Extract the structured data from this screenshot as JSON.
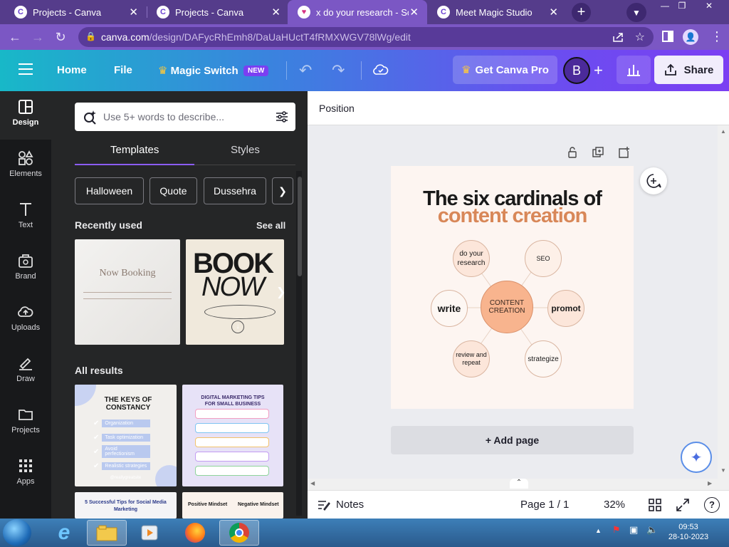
{
  "browser": {
    "tabs": [
      {
        "label": "Projects - Canva",
        "active": false
      },
      {
        "label": "Projects - Canva",
        "active": false
      },
      {
        "label": "x do your research - Soci",
        "active": true
      },
      {
        "label": "Meet Magic Studio",
        "active": false
      }
    ],
    "close_glyph": "✕",
    "new_tab_glyph": "+",
    "url_domain": "canva.com",
    "url_path": "/design/DAFycRhEmh8/DaUaHUctT4fRMXWGV78lWg/edit"
  },
  "header": {
    "home": "Home",
    "file": "File",
    "magic_switch": "Magic Switch",
    "new_badge": "NEW",
    "get_pro": "Get Canva Pro",
    "avatar_initial": "B",
    "share": "Share"
  },
  "rail": {
    "items": [
      {
        "label": "Design",
        "icon": "design-icon"
      },
      {
        "label": "Elements",
        "icon": "elements-icon"
      },
      {
        "label": "Text",
        "icon": "text-icon"
      },
      {
        "label": "Brand",
        "icon": "brand-icon"
      },
      {
        "label": "Uploads",
        "icon": "upload-cloud-icon"
      },
      {
        "label": "Draw",
        "icon": "draw-icon"
      },
      {
        "label": "Projects",
        "icon": "folder-icon"
      },
      {
        "label": "Apps",
        "icon": "apps-grid-icon"
      }
    ]
  },
  "panel": {
    "search_placeholder": "Use 5+ words to describe...",
    "tabs": [
      "Templates",
      "Styles"
    ],
    "chips": [
      "Halloween",
      "Quote",
      "Dussehra"
    ],
    "recently_used": "Recently used",
    "see_all": "See all",
    "all_results": "All results",
    "thumb_now_booking": "Now Booking",
    "thumb_book": "BOOK",
    "thumb_now": "NOW",
    "thumb_keys_title": "THE KEYS OF CONSTANCY",
    "thumb_keys_items": [
      "Organization",
      "Task optimization",
      "Avoid perfectionism",
      "Realistic strategies"
    ],
    "thumb_keys_handle": "@reallygreatsite",
    "thumb_marketing_title": "DIGITAL MARKETING TIPS FOR SMALL BUSINESS",
    "thumb_social_title": "5 Successful Tips for Social Media Marketing",
    "thumb_positive": "Positive Mindset",
    "thumb_negative": "Negative Mindset"
  },
  "canvas": {
    "position_label": "Position",
    "title_line1": "The six cardinals of",
    "title_line2": "content creation",
    "center": "CONTENT CREATION",
    "nodes": [
      {
        "label": "do your research"
      },
      {
        "label": "SEO"
      },
      {
        "label": "write"
      },
      {
        "label": "promot"
      },
      {
        "label": "review and repeat"
      },
      {
        "label": "strategize"
      }
    ],
    "add_page": "+ Add page"
  },
  "footer": {
    "notes": "Notes",
    "page": "Page 1 / 1",
    "zoom": "32%"
  },
  "taskbar": {
    "time": "09:53",
    "date": "28-10-2023"
  },
  "colors": {
    "accent": "#8b5cf6",
    "title_orange": "#d88758",
    "center_node": "#f8b48e",
    "node_fill": "#fce6da",
    "panel_bg": "#252627",
    "rail_bg": "#18191b"
  }
}
